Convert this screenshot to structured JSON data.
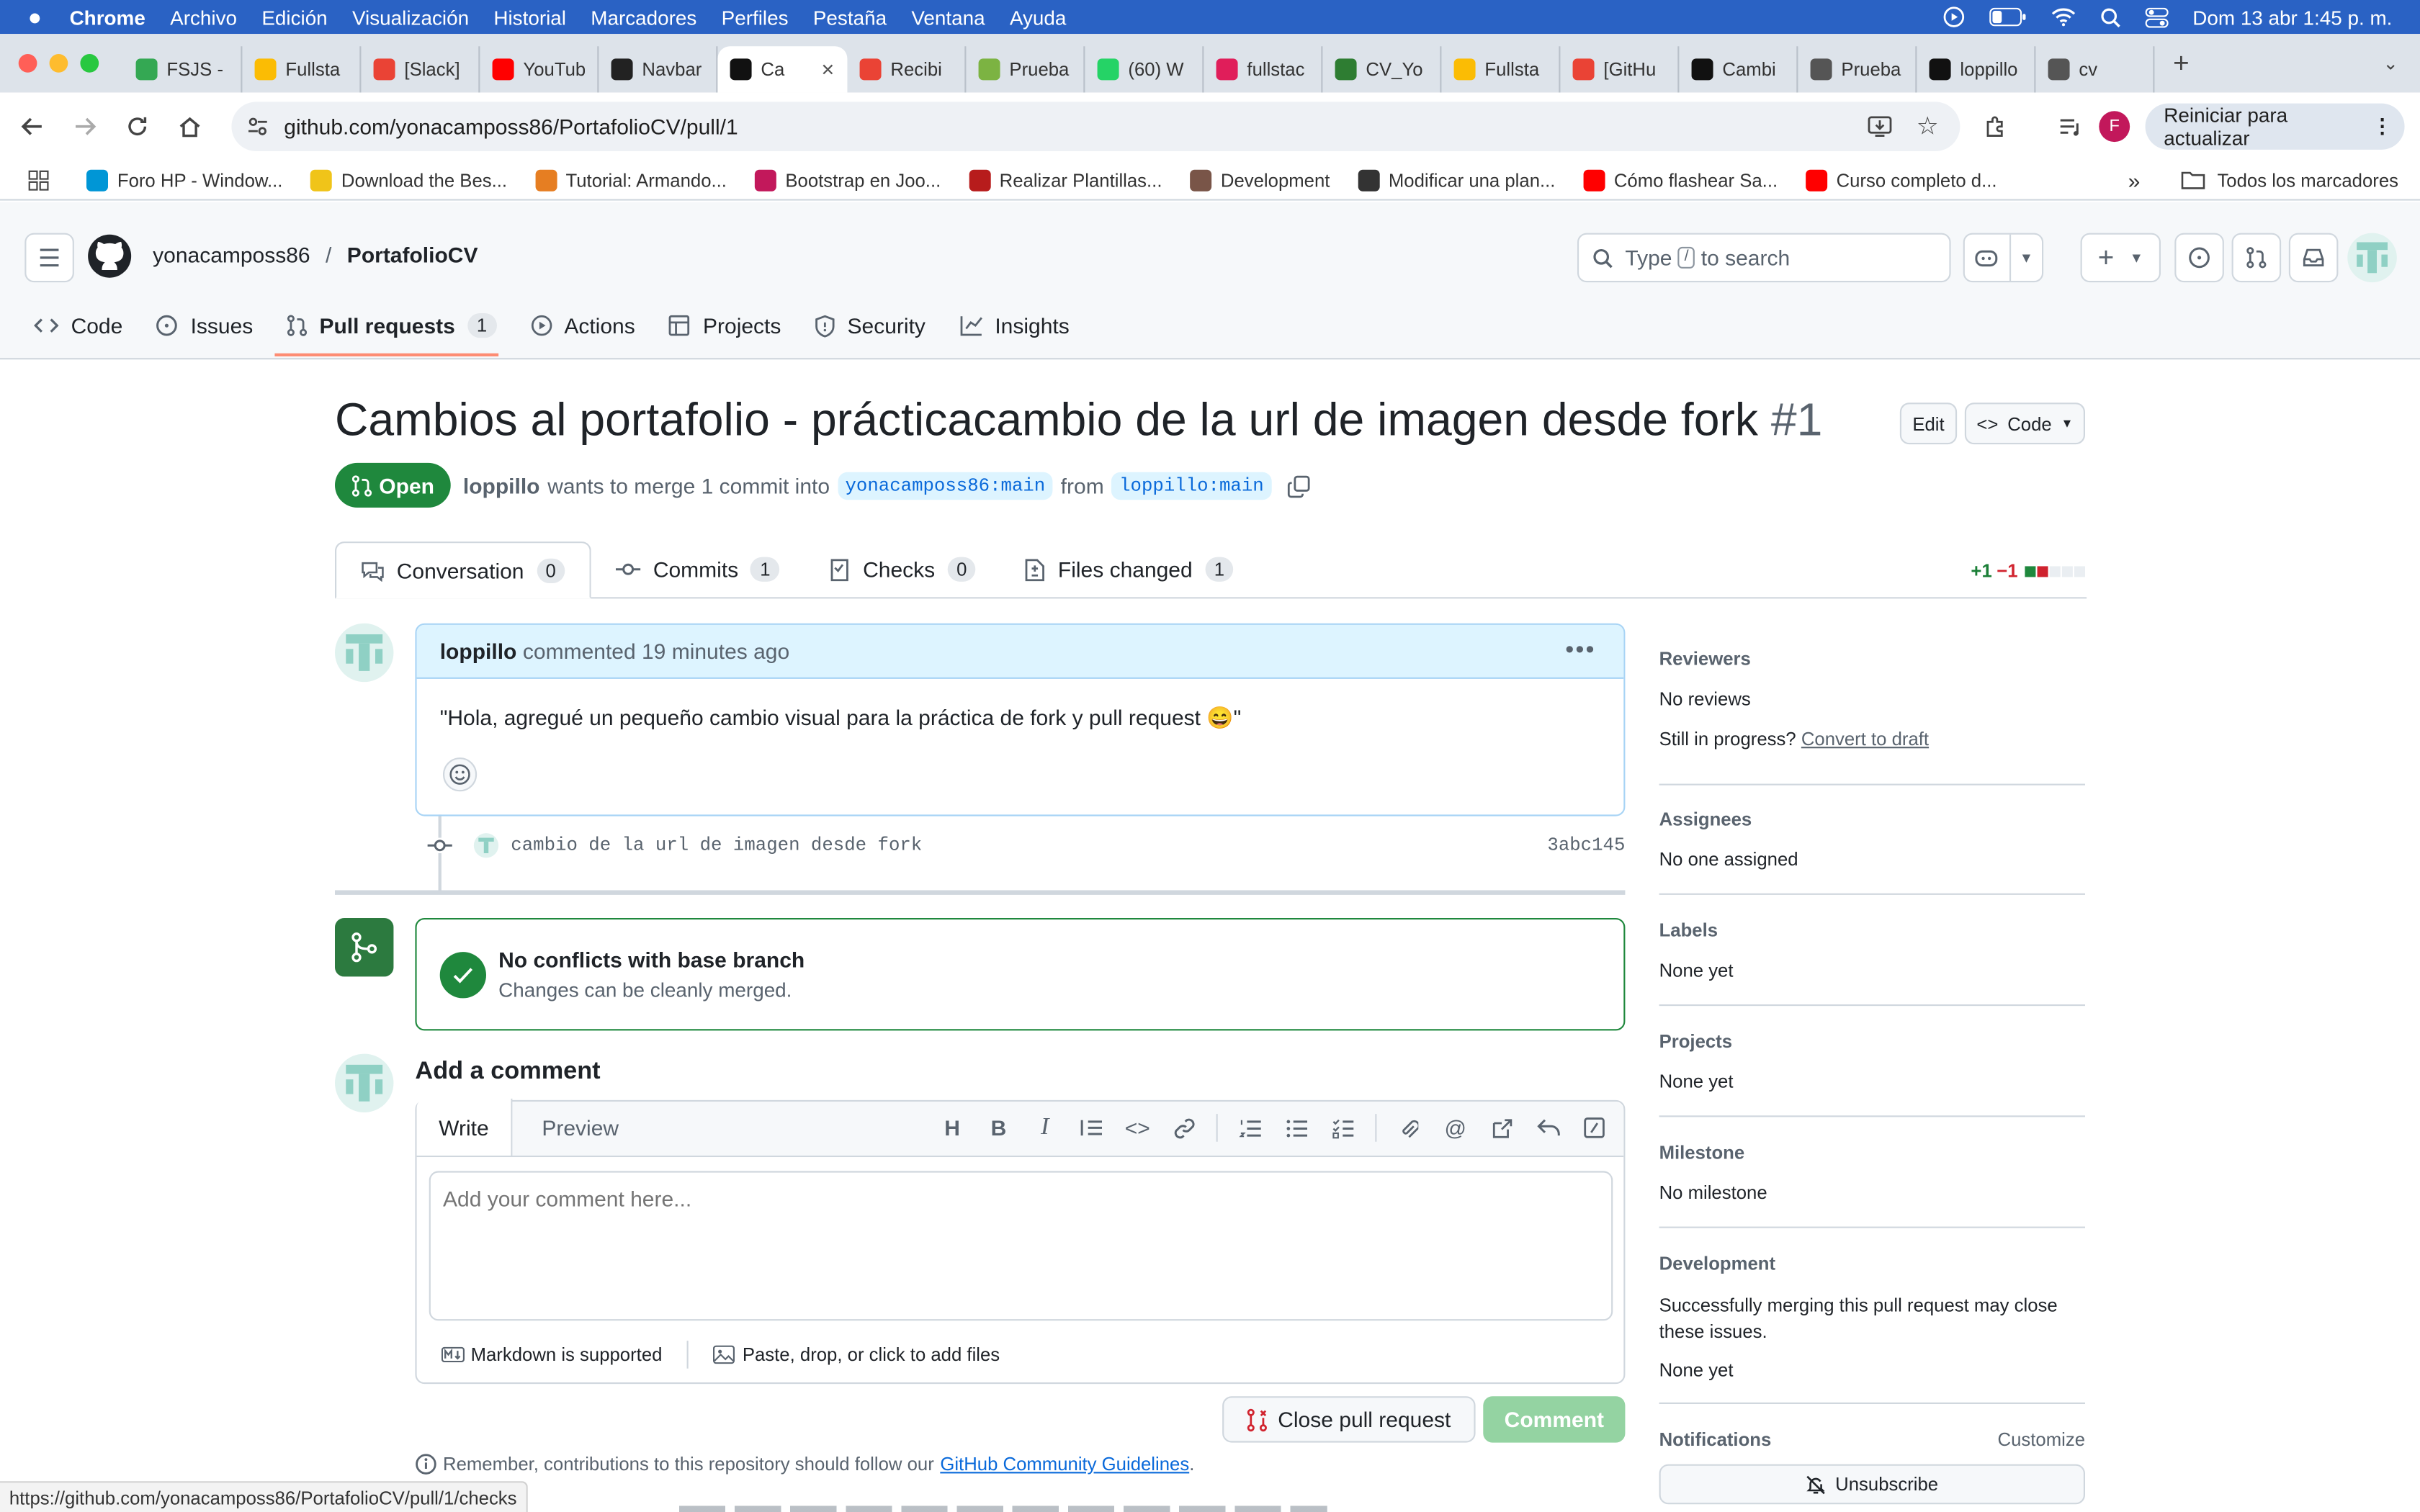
{
  "mac": {
    "apple": "",
    "app": "Chrome",
    "menus": [
      "Archivo",
      "Edición",
      "Visualización",
      "Historial",
      "Marcadores",
      "Perfiles",
      "Pestaña",
      "Ventana",
      "Ayuda"
    ],
    "clock": "Dom 13 abr 1:45 p. m."
  },
  "tabs": [
    {
      "label": "FSJS -",
      "color": "#34a853",
      "active": false
    },
    {
      "label": "Fullsta",
      "color": "#fbbc04",
      "active": false
    },
    {
      "label": "[Slack]",
      "color": "#ea4335",
      "active": false
    },
    {
      "label": "YouTub",
      "color": "#ff0000",
      "active": false
    },
    {
      "label": "Navbar",
      "color": "#222222",
      "active": false
    },
    {
      "label": "Ca",
      "color": "#111111",
      "active": true
    },
    {
      "label": "Recibi",
      "color": "#ea4335",
      "active": false
    },
    {
      "label": "Prueba",
      "color": "#7cb342",
      "active": false
    },
    {
      "label": "(60) W",
      "color": "#25d366",
      "active": false
    },
    {
      "label": "fullstac",
      "color": "#e01e5a",
      "active": false
    },
    {
      "label": "CV_Yo",
      "color": "#2e7d32",
      "active": false
    },
    {
      "label": "Fullsta",
      "color": "#fbbc04",
      "active": false
    },
    {
      "label": "[GitHu",
      "color": "#ea4335",
      "active": false
    },
    {
      "label": "Cambi",
      "color": "#111111",
      "active": false
    },
    {
      "label": "Prueba",
      "color": "#555555",
      "active": false
    },
    {
      "label": "loppillo",
      "color": "#111111",
      "active": false
    },
    {
      "label": "cv",
      "color": "#555555",
      "active": false
    }
  ],
  "browser": {
    "url": "github.com/yonacamposs86/PortafolioCV/pull/1",
    "profile_initial": "F",
    "update_label": "Reiniciar para actualizar",
    "all_bookmarks": "Todos los marcadores"
  },
  "bookmarks": [
    {
      "label": "Foro HP - Window...",
      "color": "#0096d6"
    },
    {
      "label": "Download the Bes...",
      "color": "#f0c419"
    },
    {
      "label": "Tutorial: Armando...",
      "color": "#e67e22"
    },
    {
      "label": "Bootstrap en Joo...",
      "color": "#c2185b"
    },
    {
      "label": "Realizar Plantillas...",
      "color": "#b71c1c"
    },
    {
      "label": "Development",
      "color": "#795548"
    },
    {
      "label": "Modificar una plan...",
      "color": "#333333"
    },
    {
      "label": "Cómo flashear Sa...",
      "color": "#ff0000"
    },
    {
      "label": "Curso completo d...",
      "color": "#ff0000"
    }
  ],
  "github": {
    "owner": "yonacamposs86",
    "repo": "PortafolioCV",
    "search_type": "Type",
    "search_key": "/",
    "search_rest": "to search",
    "nav": [
      {
        "label": "Code",
        "icon": "code-icon"
      },
      {
        "label": "Issues",
        "icon": "issue-icon"
      },
      {
        "label": "Pull requests",
        "icon": "pull-request-icon",
        "count": "1"
      },
      {
        "label": "Actions",
        "icon": "play-icon"
      },
      {
        "label": "Projects",
        "icon": "table-icon"
      },
      {
        "label": "Security",
        "icon": "shield-icon"
      },
      {
        "label": "Insights",
        "icon": "graph-icon"
      }
    ]
  },
  "pr": {
    "title": "Cambios al portafolio - prácticacambio de la url de imagen desde fork",
    "number": "#1",
    "edit_label": "Edit",
    "code_label": "Code",
    "state": "Open",
    "author": "loppillo",
    "merge_text": "wants to merge 1 commit into",
    "base": "yonacamposs86:main",
    "from": "from",
    "head": "loppillo:main",
    "tabs": [
      {
        "label": "Conversation",
        "count": "0"
      },
      {
        "label": "Commits",
        "count": "1"
      },
      {
        "label": "Checks",
        "count": "0"
      },
      {
        "label": "Files changed",
        "count": "1"
      }
    ],
    "additions": "+1",
    "deletions": "−1",
    "comment": {
      "author": "loppillo",
      "meta": "commented 19 minutes ago",
      "body": "\"Hola, agregué un pequeño cambio visual para la práctica de fork y pull request 😄\""
    },
    "commit": {
      "message": "cambio de la url de imagen desde fork",
      "sha": "3abc145"
    },
    "merge": {
      "title": "No conflicts with base branch",
      "subtitle": "Changes can be cleanly merged."
    },
    "add_comment": {
      "heading": "Add a comment",
      "write": "Write",
      "preview": "Preview",
      "placeholder": "Add your comment here...",
      "markdown": "Markdown is supported",
      "files": "Paste, drop, or click to add files",
      "close_btn": "Close pull request",
      "comment_btn": "Comment",
      "remember": "Remember, contributions to this repository should follow our",
      "guidelines": "GitHub Community Guidelines",
      "period": "."
    }
  },
  "sidebar": {
    "reviewers": {
      "title": "Reviewers",
      "value": "No reviews",
      "q": "Still in progress?",
      "link": "Convert to draft"
    },
    "assignees": {
      "title": "Assignees",
      "value": "No one assigned"
    },
    "labels": {
      "title": "Labels",
      "value": "None yet"
    },
    "projects": {
      "title": "Projects",
      "value": "None yet"
    },
    "milestone": {
      "title": "Milestone",
      "value": "No milestone"
    },
    "development": {
      "title": "Development",
      "desc": "Successfully merging this pull request may close these issues.",
      "value": "None yet"
    },
    "notifications": {
      "title": "Notifications",
      "customize": "Customize",
      "unsubscribe": "Unsubscribe"
    }
  },
  "statusbar": "https://github.com/yonacamposs86/PortafolioCV/pull/1/checks",
  "colors": {
    "green": "#1f883d",
    "darkgreen": "#2c7a3f",
    "link": "#0969da",
    "mac_menubar": "#2a62c4"
  }
}
